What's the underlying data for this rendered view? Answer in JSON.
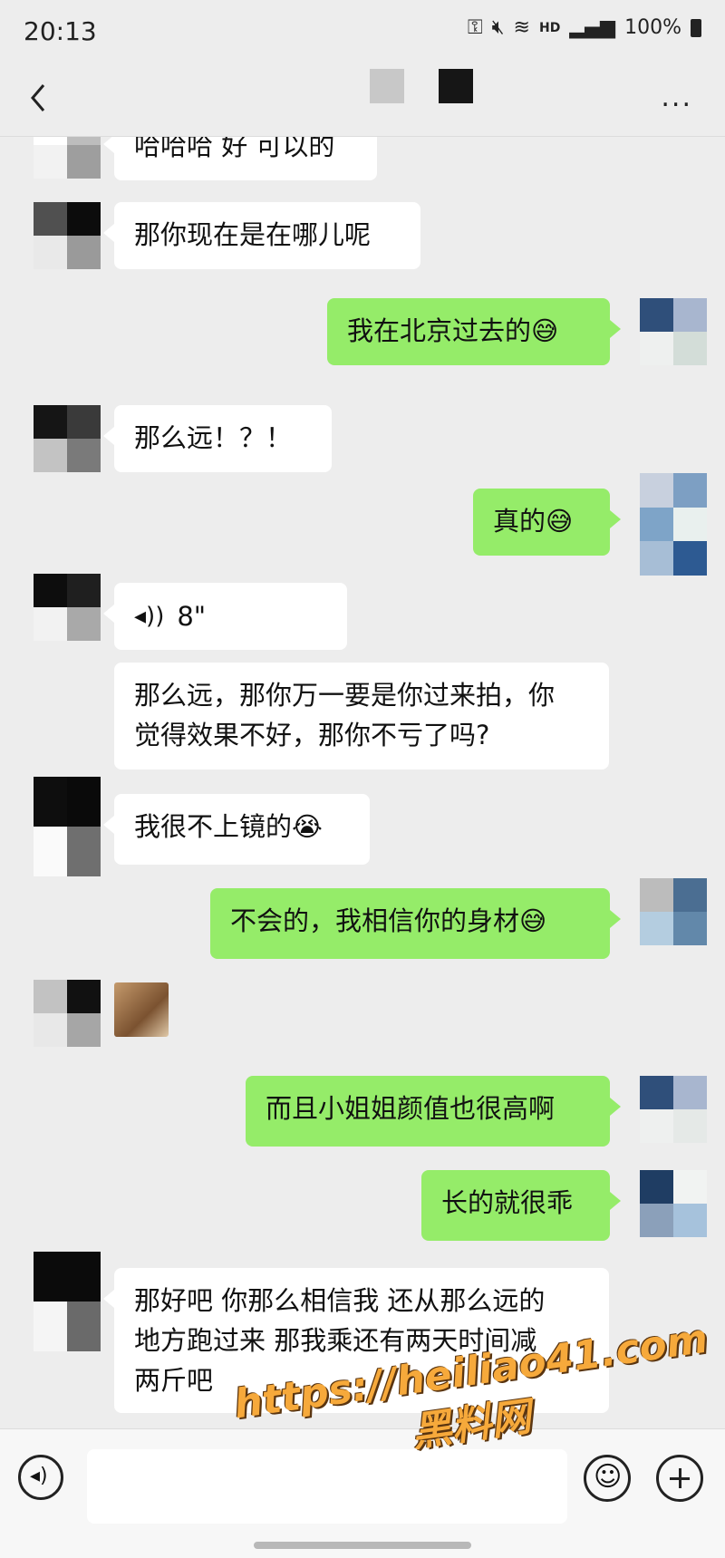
{
  "status_bar": {
    "time": "20:13",
    "hd": "HD",
    "battery": "100%"
  },
  "header": {
    "more_label": "..."
  },
  "messages": [
    {
      "side": "in",
      "text": "哈哈哈 好 可以的"
    },
    {
      "side": "in",
      "text": "那你现在是在哪儿呢"
    },
    {
      "side": "out",
      "text": "我在北京过去的😅"
    },
    {
      "side": "in",
      "text": "那么远！？！"
    },
    {
      "side": "out",
      "text": "真的😅"
    },
    {
      "side": "in",
      "type": "voice",
      "duration": "8\""
    },
    {
      "side": "in",
      "text": "那么远，那你万一要是你过来拍，你\n觉得效果不好，那你不亏了吗?"
    },
    {
      "side": "in",
      "text": "我很不上镜的😭"
    },
    {
      "side": "out",
      "text": "不会的，我相信你的身材😅"
    },
    {
      "side": "in",
      "type": "image"
    },
    {
      "side": "out",
      "text": "而且小姐姐颜值也很高啊"
    },
    {
      "side": "out",
      "text": "长的就很乖"
    },
    {
      "side": "in",
      "text": "那好吧 你那么相信我 还从那么远的\n地方跑过来 那我乘还有两天时间减\n两斤吧"
    }
  ],
  "watermark": {
    "line1": "https://heiliao41.com",
    "line2": "黑料网"
  },
  "colors": {
    "background": "#ededed",
    "outgoing_bubble": "#95ec69",
    "incoming_bubble": "#ffffff"
  }
}
